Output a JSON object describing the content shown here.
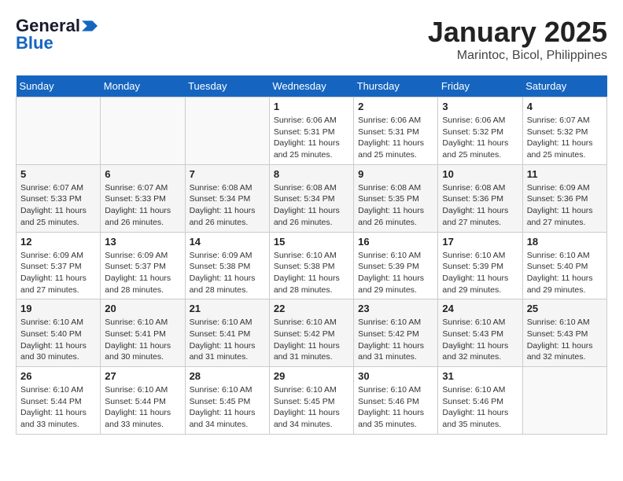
{
  "header": {
    "logo_general": "General",
    "logo_blue": "Blue",
    "month_title": "January 2025",
    "location": "Marintoc, Bicol, Philippines"
  },
  "weekdays": [
    "Sunday",
    "Monday",
    "Tuesday",
    "Wednesday",
    "Thursday",
    "Friday",
    "Saturday"
  ],
  "weeks": [
    [
      {
        "day": "",
        "info": ""
      },
      {
        "day": "",
        "info": ""
      },
      {
        "day": "",
        "info": ""
      },
      {
        "day": "1",
        "info": "Sunrise: 6:06 AM\nSunset: 5:31 PM\nDaylight: 11 hours and 25 minutes."
      },
      {
        "day": "2",
        "info": "Sunrise: 6:06 AM\nSunset: 5:31 PM\nDaylight: 11 hours and 25 minutes."
      },
      {
        "day": "3",
        "info": "Sunrise: 6:06 AM\nSunset: 5:32 PM\nDaylight: 11 hours and 25 minutes."
      },
      {
        "day": "4",
        "info": "Sunrise: 6:07 AM\nSunset: 5:32 PM\nDaylight: 11 hours and 25 minutes."
      }
    ],
    [
      {
        "day": "5",
        "info": "Sunrise: 6:07 AM\nSunset: 5:33 PM\nDaylight: 11 hours and 25 minutes."
      },
      {
        "day": "6",
        "info": "Sunrise: 6:07 AM\nSunset: 5:33 PM\nDaylight: 11 hours and 26 minutes."
      },
      {
        "day": "7",
        "info": "Sunrise: 6:08 AM\nSunset: 5:34 PM\nDaylight: 11 hours and 26 minutes."
      },
      {
        "day": "8",
        "info": "Sunrise: 6:08 AM\nSunset: 5:34 PM\nDaylight: 11 hours and 26 minutes."
      },
      {
        "day": "9",
        "info": "Sunrise: 6:08 AM\nSunset: 5:35 PM\nDaylight: 11 hours and 26 minutes."
      },
      {
        "day": "10",
        "info": "Sunrise: 6:08 AM\nSunset: 5:36 PM\nDaylight: 11 hours and 27 minutes."
      },
      {
        "day": "11",
        "info": "Sunrise: 6:09 AM\nSunset: 5:36 PM\nDaylight: 11 hours and 27 minutes."
      }
    ],
    [
      {
        "day": "12",
        "info": "Sunrise: 6:09 AM\nSunset: 5:37 PM\nDaylight: 11 hours and 27 minutes."
      },
      {
        "day": "13",
        "info": "Sunrise: 6:09 AM\nSunset: 5:37 PM\nDaylight: 11 hours and 28 minutes."
      },
      {
        "day": "14",
        "info": "Sunrise: 6:09 AM\nSunset: 5:38 PM\nDaylight: 11 hours and 28 minutes."
      },
      {
        "day": "15",
        "info": "Sunrise: 6:10 AM\nSunset: 5:38 PM\nDaylight: 11 hours and 28 minutes."
      },
      {
        "day": "16",
        "info": "Sunrise: 6:10 AM\nSunset: 5:39 PM\nDaylight: 11 hours and 29 minutes."
      },
      {
        "day": "17",
        "info": "Sunrise: 6:10 AM\nSunset: 5:39 PM\nDaylight: 11 hours and 29 minutes."
      },
      {
        "day": "18",
        "info": "Sunrise: 6:10 AM\nSunset: 5:40 PM\nDaylight: 11 hours and 29 minutes."
      }
    ],
    [
      {
        "day": "19",
        "info": "Sunrise: 6:10 AM\nSunset: 5:40 PM\nDaylight: 11 hours and 30 minutes."
      },
      {
        "day": "20",
        "info": "Sunrise: 6:10 AM\nSunset: 5:41 PM\nDaylight: 11 hours and 30 minutes."
      },
      {
        "day": "21",
        "info": "Sunrise: 6:10 AM\nSunset: 5:41 PM\nDaylight: 11 hours and 31 minutes."
      },
      {
        "day": "22",
        "info": "Sunrise: 6:10 AM\nSunset: 5:42 PM\nDaylight: 11 hours and 31 minutes."
      },
      {
        "day": "23",
        "info": "Sunrise: 6:10 AM\nSunset: 5:42 PM\nDaylight: 11 hours and 31 minutes."
      },
      {
        "day": "24",
        "info": "Sunrise: 6:10 AM\nSunset: 5:43 PM\nDaylight: 11 hours and 32 minutes."
      },
      {
        "day": "25",
        "info": "Sunrise: 6:10 AM\nSunset: 5:43 PM\nDaylight: 11 hours and 32 minutes."
      }
    ],
    [
      {
        "day": "26",
        "info": "Sunrise: 6:10 AM\nSunset: 5:44 PM\nDaylight: 11 hours and 33 minutes."
      },
      {
        "day": "27",
        "info": "Sunrise: 6:10 AM\nSunset: 5:44 PM\nDaylight: 11 hours and 33 minutes."
      },
      {
        "day": "28",
        "info": "Sunrise: 6:10 AM\nSunset: 5:45 PM\nDaylight: 11 hours and 34 minutes."
      },
      {
        "day": "29",
        "info": "Sunrise: 6:10 AM\nSunset: 5:45 PM\nDaylight: 11 hours and 34 minutes."
      },
      {
        "day": "30",
        "info": "Sunrise: 6:10 AM\nSunset: 5:46 PM\nDaylight: 11 hours and 35 minutes."
      },
      {
        "day": "31",
        "info": "Sunrise: 6:10 AM\nSunset: 5:46 PM\nDaylight: 11 hours and 35 minutes."
      },
      {
        "day": "",
        "info": ""
      }
    ]
  ]
}
